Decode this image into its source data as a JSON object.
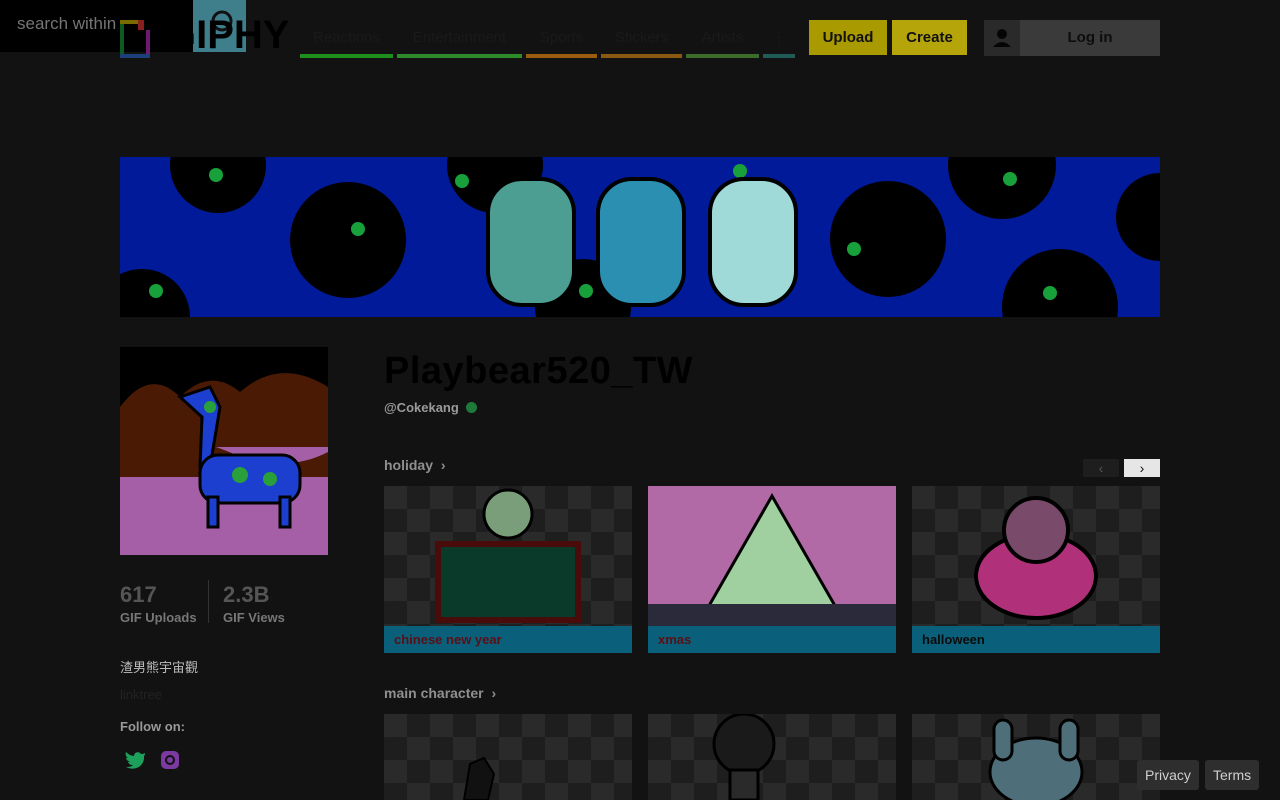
{
  "search": {
    "placeholder": "search within"
  },
  "logo": {
    "text": "GIPHY"
  },
  "nav": {
    "items": [
      {
        "label": "Reactions",
        "color": "#1e8e1e"
      },
      {
        "label": "Entertainment",
        "color": "#2d8b2a"
      },
      {
        "label": "Sports",
        "color": "#9a5c0e"
      },
      {
        "label": "Stickers",
        "color": "#8a5a12"
      },
      {
        "label": "Artists",
        "color": "#3d6b2a"
      }
    ],
    "more_label": "⋮",
    "upload_label": "Upload",
    "create_label": "Create",
    "login_label": "Log in"
  },
  "profile": {
    "name": "Playbear520_TW",
    "handle": "@Cokekang",
    "verified": true,
    "uploads_count": "617",
    "uploads_label": "GIF Uploads",
    "views_count": "2.3B",
    "views_label": "GIF Views",
    "bio": "渣男熊宇宙觀",
    "link": "linktree",
    "follow_label": "Follow on:"
  },
  "sections": [
    {
      "title": "holiday",
      "cards": [
        {
          "caption": "chinese new year",
          "caption_color": "#5a0f16"
        },
        {
          "caption": "xmas",
          "caption_color": "#5a0f16"
        },
        {
          "caption": "halloween",
          "caption_color": "#0b0b0b"
        }
      ]
    },
    {
      "title": "main character",
      "cards": [
        {
          "caption": ""
        },
        {
          "caption": ""
        },
        {
          "caption": ""
        }
      ]
    }
  ],
  "footer": {
    "privacy": "Privacy",
    "terms": "Terms"
  },
  "colors": {
    "background": "#121212",
    "upload_button": "#a99a00",
    "create_button": "#b5a40a",
    "banner": "#001a99",
    "caption_bar": "#0a607a"
  }
}
